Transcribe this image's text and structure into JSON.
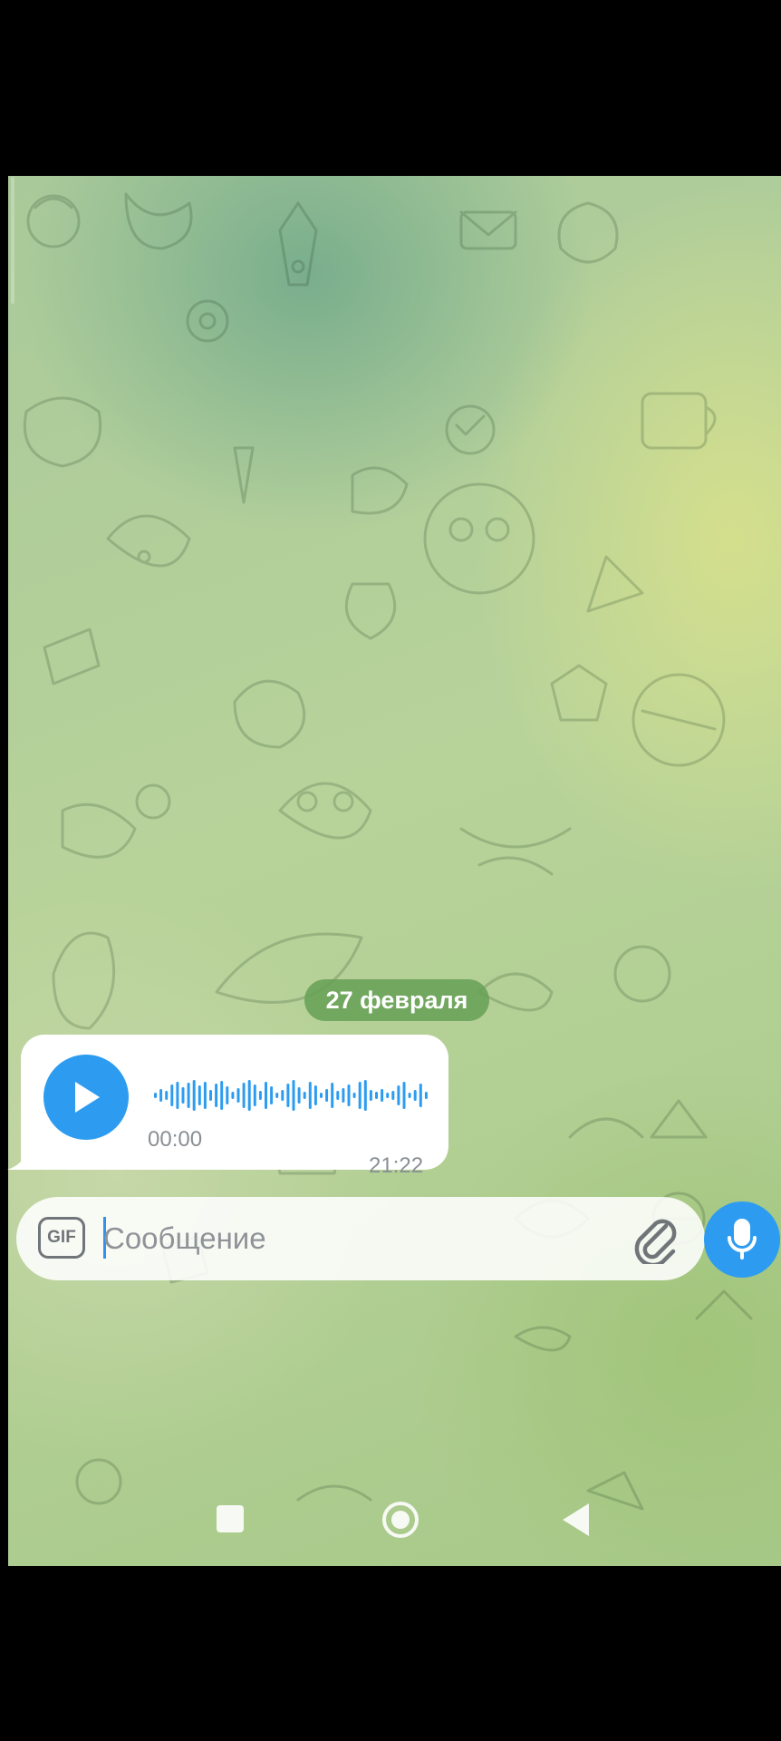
{
  "chat": {
    "date_separator": "27 февраля",
    "voice_message": {
      "duration": "00:00",
      "time": "21:22"
    }
  },
  "composer": {
    "gif_label": "GIF",
    "placeholder": "Сообщение",
    "value": ""
  },
  "icons": {
    "play": "play-icon",
    "attach": "paperclip-icon",
    "mic": "microphone-icon",
    "nav_recents": "square-icon",
    "nav_home": "circle-icon",
    "nav_back": "triangle-back-icon"
  },
  "colors": {
    "accent": "#2d9cf0",
    "date_pill": "#68a056",
    "bubble": "#ffffff",
    "meta_text": "#8a8f94"
  }
}
